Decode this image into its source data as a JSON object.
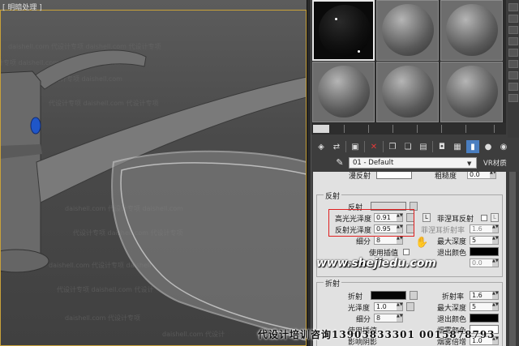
{
  "viewport": {
    "label": "[ 明暗处理 ]",
    "bg_text": [
      "daishell.com",
      "代设计专项"
    ]
  },
  "material_editor": {
    "slots": [
      {
        "index": 1,
        "style": "black-glossy",
        "active": true
      },
      {
        "index": 2,
        "style": "gray",
        "active": false
      },
      {
        "index": 3,
        "style": "gray",
        "active": false
      },
      {
        "index": 4,
        "style": "gray",
        "active": false
      },
      {
        "index": 5,
        "style": "gray",
        "active": false
      },
      {
        "index": 6,
        "style": "gray",
        "active": false
      }
    ],
    "toolbar_icons": [
      "get-material-icon",
      "put-to-scene-icon",
      "assign-material-icon",
      "reset-map-icon",
      "make-copy-icon",
      "make-unique-icon",
      "put-to-library-icon",
      "material-id-icon",
      "show-map-icon",
      "show-end-result-icon",
      "go-to-parent-icon",
      "go-forward-icon"
    ],
    "material_name": "01 - Default",
    "material_type": "VR材质"
  },
  "params": {
    "top_row": {
      "label_left": "漫反射",
      "label_right": "粗糙度",
      "right_value": "0.0"
    },
    "reflection_group": {
      "title": "反射",
      "reflect_label": "反射",
      "highlight_gloss_label": "高光光泽度",
      "highlight_gloss_value": "0.91",
      "refl_gloss_label": "反射光泽度",
      "refl_gloss_value": "0.95",
      "L_label": "L",
      "fresnel_label": "菲涅耳反射",
      "fresnel_ior_label": "菲涅耳折射率",
      "fresnel_ior_value": "1.6",
      "subdivs_label": "细分",
      "subdivs_value": "8",
      "max_depth_label": "最大深度",
      "max_depth_value": "5",
      "interp_label": "使用插值",
      "exit_color_label": "退出颜色",
      "dim_dist_label": "暗淡距离",
      "dim_dist_value": "0.0"
    },
    "refraction_group": {
      "title": "折射",
      "refract_label": "折射",
      "ior_label": "折射率",
      "ior_value": "1.6",
      "gloss_label": "光泽度",
      "gloss_value": "1.0",
      "max_depth_label": "最大深度",
      "max_depth_value": "5",
      "subdivs_label": "细分",
      "subdivs_value": "8",
      "exit_color_label": "退出颜色",
      "interp_label": "使用插值",
      "fog_color_label": "烟雾颜色",
      "shadows_label": "影响阴影",
      "fog_mult_label": "烟雾倍增",
      "fog_mult_value": "1.0"
    }
  },
  "overlays": {
    "watermark": "www.shejiedu.com",
    "bottom_text": "代设计培训咨询13903833301 0015878793"
  },
  "colors": {
    "viewport_frame": "#c8a13a",
    "highlight_box": "#e02020",
    "active_tool": "#4a7ec0",
    "faucet_accent": "#1f56c8"
  }
}
